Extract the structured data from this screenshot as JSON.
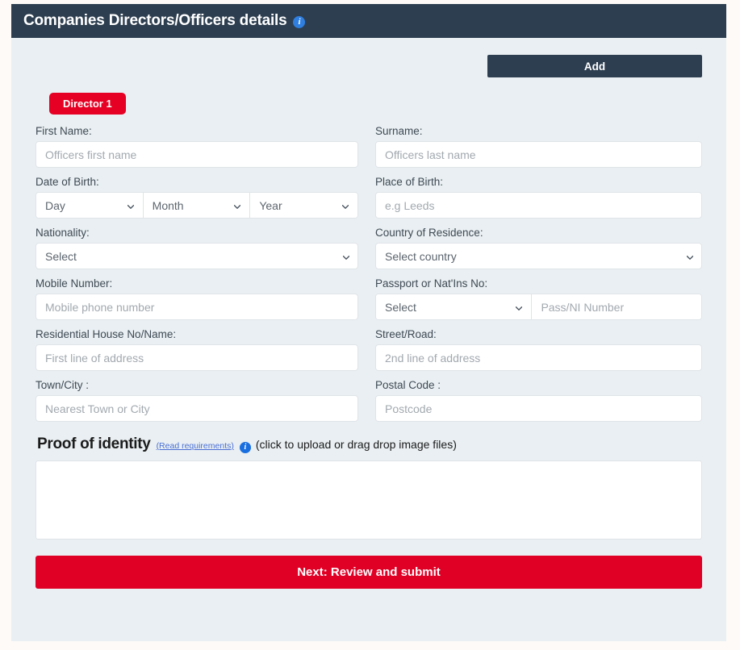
{
  "header": {
    "title": "Companies Directors/Officers details",
    "info_icon": "info-circle-icon",
    "bg_color": "#2d3e50"
  },
  "toolbar": {
    "add_label": "Add"
  },
  "tabs": [
    {
      "label": "Director 1",
      "active": true,
      "color": "#e60023"
    }
  ],
  "form": {
    "rows": [
      {
        "left": {
          "label": "First Name:",
          "type": "text",
          "placeholder": "Officers first name",
          "value": ""
        },
        "right": {
          "label": "Surname:",
          "type": "text",
          "placeholder": "Officers last name",
          "value": ""
        }
      },
      {
        "left": {
          "label": "Date of Birth:",
          "type": "date-group",
          "parts": [
            {
              "name": "day",
              "selected": "Day"
            },
            {
              "name": "month",
              "selected": "Month"
            },
            {
              "name": "year",
              "selected": "Year"
            }
          ]
        },
        "right": {
          "label": "Place of Birth:",
          "type": "text",
          "placeholder": "e.g Leeds",
          "value": ""
        }
      },
      {
        "left": {
          "label": "Nationality:",
          "type": "select",
          "selected": "Select"
        },
        "right": {
          "label": "Country of Residence:",
          "type": "select",
          "selected": "Select country"
        }
      },
      {
        "left": {
          "label": "Mobile Number:",
          "type": "text",
          "placeholder": "Mobile phone number",
          "value": ""
        },
        "right": {
          "label": "Passport or Nat'Ins No:",
          "type": "combo",
          "selected": "Select",
          "placeholder": "Pass/NI Number",
          "value": ""
        }
      },
      {
        "left": {
          "label": "Residential House No/Name:",
          "type": "text",
          "placeholder": "First line of address",
          "value": ""
        },
        "right": {
          "label": "Street/Road:",
          "type": "text",
          "placeholder": "2nd line of address",
          "value": ""
        }
      },
      {
        "left": {
          "label": "Town/City :",
          "type": "text",
          "placeholder": "Nearest Town or City",
          "value": ""
        },
        "right": {
          "label": "Postal Code :",
          "type": "text",
          "placeholder": "Postcode",
          "value": ""
        }
      }
    ]
  },
  "proof": {
    "title": "Proof of identity",
    "link_label": "(Read requirements)",
    "info_icon": "info-circle-icon",
    "hint": "(click to upload or drag drop image files)",
    "dropzone_content": ""
  },
  "submit": {
    "label": "Next: Review and submit",
    "color": "#e00025"
  },
  "colors": {
    "panel_bg": "#e9eff2",
    "page_bg": "#fdfaf7",
    "header_bg": "#2d3e50",
    "accent_red": "#e60023",
    "link_blue": "#4a6fd4",
    "info_blue": "#1a6fe0",
    "input_border": "#dfe4e8"
  }
}
